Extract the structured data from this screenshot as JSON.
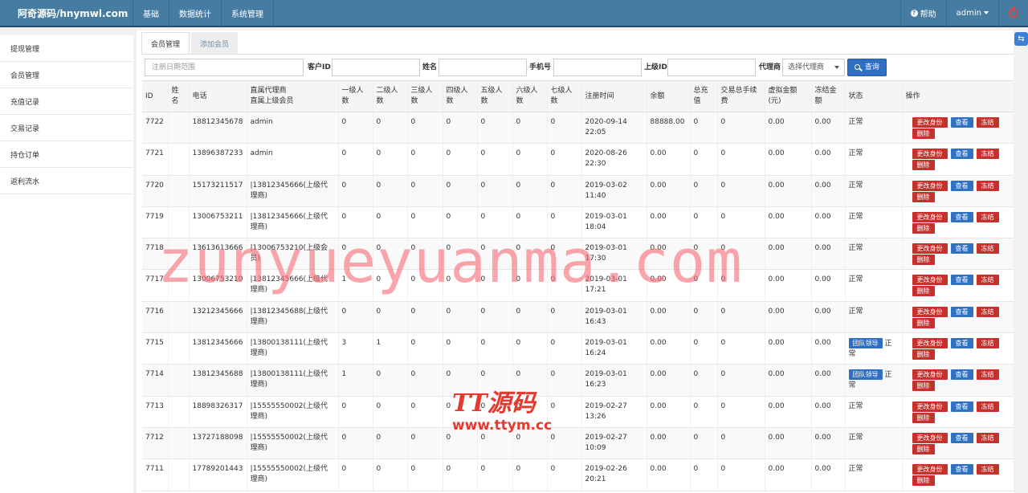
{
  "app": {
    "brand": "阿奇源码/hnymwl.com"
  },
  "topnav": [
    "基础",
    "数据统计",
    "系统管理"
  ],
  "topright": {
    "help": "帮助",
    "user": "admin"
  },
  "sidebar": [
    "提现管理",
    "会员管理",
    "充值记录",
    "交易记录",
    "持仓订单",
    "返利流水"
  ],
  "tabs": [
    "会员管理",
    "添加会员"
  ],
  "filters": {
    "date_placeholder": "注册日期范围",
    "customer_id_label": "客户ID",
    "name_label": "姓名",
    "phone_label": "手机号",
    "parent_id_label": "上级ID",
    "agent_label": "代理商",
    "agent_select": "选择代理商",
    "search_button": "查询"
  },
  "table": {
    "headers": [
      "ID",
      "姓名",
      "电话",
      "直属代理商\n直属上级会员",
      "一级人数",
      "二级人数",
      "三级人数",
      "四级人数",
      "五级人数",
      "六级人数",
      "七级人数",
      "注册时间",
      "余额",
      "总充值",
      "交易总手续费",
      "虚拟金额(元)",
      "冻结金额",
      "状态",
      "操作"
    ],
    "actions": {
      "change": "更改身份",
      "view": "查看",
      "freeze": "冻结",
      "delete": "删除"
    },
    "badge_label": "团队领导",
    "rows": [
      {
        "id": "7722",
        "name": "",
        "phone": "18812345678",
        "agent": "admin",
        "l1": "0",
        "l2": "0",
        "l3": "0",
        "l4": "0",
        "l5": "0",
        "l6": "0",
        "l7": "0",
        "reg": "2020-09-14 22:05",
        "balance": "88888.00",
        "recharge": "0",
        "fee": "0",
        "virtual": "0.00",
        "frozen": "0.00",
        "status": "正常",
        "badge": false
      },
      {
        "id": "7721",
        "name": "",
        "phone": "13896387233",
        "agent": "admin",
        "l1": "0",
        "l2": "0",
        "l3": "0",
        "l4": "0",
        "l5": "0",
        "l6": "0",
        "l7": "0",
        "reg": "2020-08-26 22:30",
        "balance": "0.00",
        "recharge": "0",
        "fee": "0",
        "virtual": "0.00",
        "frozen": "0.00",
        "status": "正常",
        "badge": false
      },
      {
        "id": "7720",
        "name": "",
        "phone": "15173211517",
        "agent": "|13812345666(上级代理商)",
        "l1": "0",
        "l2": "0",
        "l3": "0",
        "l4": "0",
        "l5": "0",
        "l6": "0",
        "l7": "0",
        "reg": "2019-03-02 11:40",
        "balance": "0.00",
        "recharge": "0",
        "fee": "0",
        "virtual": "0.00",
        "frozen": "0.00",
        "status": "正常",
        "badge": false
      },
      {
        "id": "7719",
        "name": "",
        "phone": "13006753211",
        "agent": "|13812345666(上级代理商)",
        "l1": "0",
        "l2": "0",
        "l3": "0",
        "l4": "0",
        "l5": "0",
        "l6": "0",
        "l7": "0",
        "reg": "2019-03-01 18:04",
        "balance": "0.00",
        "recharge": "0",
        "fee": "0",
        "virtual": "0.00",
        "frozen": "0.00",
        "status": "正常",
        "badge": false
      },
      {
        "id": "7718",
        "name": "",
        "phone": "13613613666",
        "agent": "|13006753210(上级会员)",
        "l1": "0",
        "l2": "0",
        "l3": "0",
        "l4": "0",
        "l5": "0",
        "l6": "0",
        "l7": "0",
        "reg": "2019-03-01 17:30",
        "balance": "0.00",
        "recharge": "0",
        "fee": "0",
        "virtual": "0.00",
        "frozen": "0.00",
        "status": "正常",
        "badge": false
      },
      {
        "id": "7717",
        "name": "",
        "phone": "13006753210",
        "agent": "|13812345666(上级代理商)",
        "l1": "1",
        "l2": "0",
        "l3": "0",
        "l4": "0",
        "l5": "0",
        "l6": "0",
        "l7": "0",
        "reg": "2019-03-01 17:21",
        "balance": "0.00",
        "recharge": "0",
        "fee": "0",
        "virtual": "0.00",
        "frozen": "0.00",
        "status": "正常",
        "badge": false
      },
      {
        "id": "7716",
        "name": "",
        "phone": "13212345666",
        "agent": "|13812345688(上级代理商)",
        "l1": "0",
        "l2": "0",
        "l3": "0",
        "l4": "0",
        "l5": "0",
        "l6": "0",
        "l7": "0",
        "reg": "2019-03-01 16:43",
        "balance": "0.00",
        "recharge": "0",
        "fee": "0",
        "virtual": "0.00",
        "frozen": "0.00",
        "status": "正常",
        "badge": false
      },
      {
        "id": "7715",
        "name": "",
        "phone": "13812345666",
        "agent": "|13800138111(上级代理商)",
        "l1": "3",
        "l2": "1",
        "l3": "0",
        "l4": "0",
        "l5": "0",
        "l6": "0",
        "l7": "0",
        "reg": "2019-03-01 16:24",
        "balance": "0.00",
        "recharge": "0",
        "fee": "0",
        "virtual": "0.00",
        "frozen": "0.00",
        "status": "正常",
        "badge": true
      },
      {
        "id": "7714",
        "name": "",
        "phone": "13812345688",
        "agent": "|13800138111(上级代理商)",
        "l1": "1",
        "l2": "0",
        "l3": "0",
        "l4": "0",
        "l5": "0",
        "l6": "0",
        "l7": "0",
        "reg": "2019-03-01 16:23",
        "balance": "0.00",
        "recharge": "0",
        "fee": "0",
        "virtual": "0.00",
        "frozen": "0.00",
        "status": "正常",
        "badge": true
      },
      {
        "id": "7713",
        "name": "",
        "phone": "18898326317",
        "agent": "|15555550002(上级代理商)",
        "l1": "0",
        "l2": "0",
        "l3": "0",
        "l4": "0",
        "l5": "0",
        "l6": "0",
        "l7": "0",
        "reg": "2019-02-27 13:26",
        "balance": "0.00",
        "recharge": "0",
        "fee": "0",
        "virtual": "0.00",
        "frozen": "0.00",
        "status": "正常",
        "badge": false
      },
      {
        "id": "7712",
        "name": "",
        "phone": "13727188098",
        "agent": "|15555550002(上级代理商)",
        "l1": "0",
        "l2": "0",
        "l3": "0",
        "l4": "0",
        "l5": "0",
        "l6": "0",
        "l7": "0",
        "reg": "2019-02-27 10:09",
        "balance": "0.00",
        "recharge": "0",
        "fee": "0",
        "virtual": "0.00",
        "frozen": "0.00",
        "status": "正常",
        "badge": false
      },
      {
        "id": "7711",
        "name": "",
        "phone": "17789201443",
        "agent": "|15555550002(上级代理商)",
        "l1": "0",
        "l2": "0",
        "l3": "0",
        "l4": "0",
        "l5": "0",
        "l6": "0",
        "l7": "0",
        "reg": "2019-02-26 20:21",
        "balance": "0.00",
        "recharge": "0",
        "fee": "0",
        "virtual": "0.00",
        "frozen": "0.00",
        "status": "正常",
        "badge": false
      }
    ]
  },
  "watermarks": {
    "main": "zunyueyuanma.com",
    "logo_title": "TT源码",
    "logo_url": "www.ttym.cc"
  },
  "colors": {
    "topbar": "#467ca2",
    "primary": "#2e6fc3",
    "danger": "#c9302c",
    "count_red": "#d9302a",
    "count_blue": "#2b3fd1"
  }
}
